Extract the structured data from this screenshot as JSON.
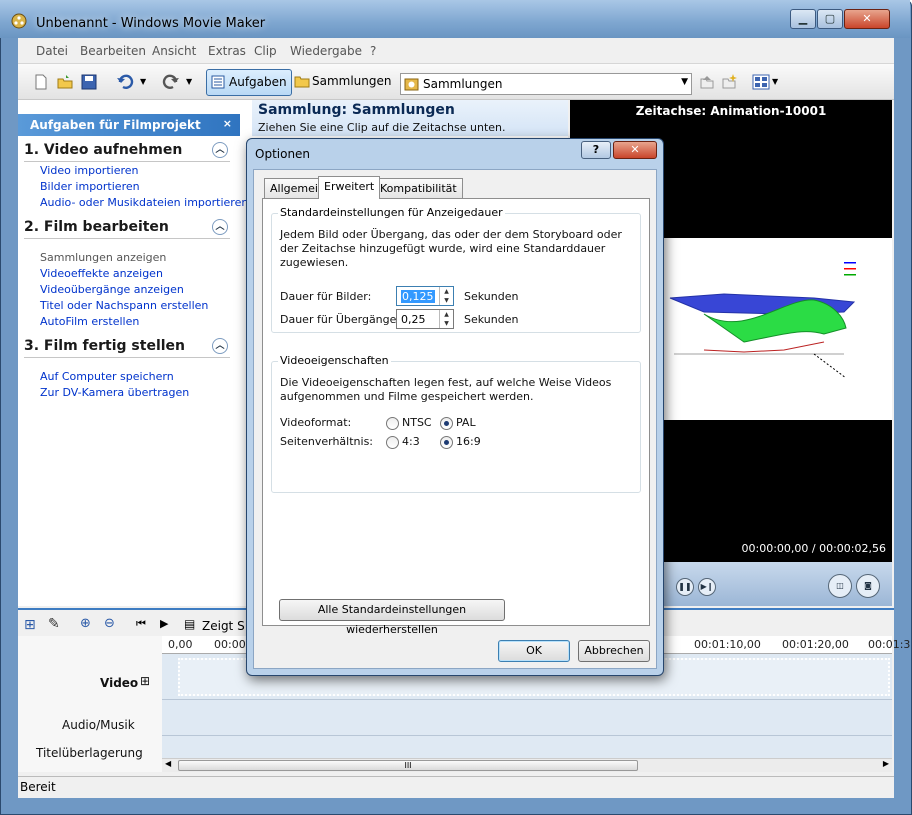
{
  "window": {
    "title": "Unbenannt - Windows Movie Maker",
    "min": "▁",
    "max": "▢",
    "close": "✕"
  },
  "menu": [
    "Datei",
    "Bearbeiten",
    "Ansicht",
    "Extras",
    "Clip",
    "Wiedergabe",
    "?"
  ],
  "toolbar": {
    "aufgaben": "Aufgaben",
    "sammlungen": "Sammlungen",
    "combo": "Sammlungen"
  },
  "tasks": {
    "header": "Aufgaben für Filmprojekt",
    "close": "×",
    "sections": [
      {
        "title": "1. Video aufnehmen",
        "links": [
          "Video importieren",
          "Bilder importieren",
          "Audio- oder Musikdateien importieren"
        ]
      },
      {
        "title": "2. Film bearbeiten",
        "links": [
          "Sammlungen anzeigen",
          "Videoeffekte anzeigen",
          "Videoübergänge anzeigen",
          "Titel oder Nachspann erstellen",
          "AutoFilm erstellen"
        ]
      },
      {
        "title": "3. Film fertig stellen",
        "links": [
          "Auf Computer speichern",
          "Zur DV-Kamera übertragen"
        ]
      }
    ]
  },
  "collection": {
    "title": "Sammlung: Sammlungen",
    "subtitle": "Ziehen Sie eine Clip auf die Zeitachse unten."
  },
  "preview": {
    "title": "Zeitachse: Animation-10001",
    "time": "00:00:00,00 / 00:00:02,56"
  },
  "timeline": {
    "zeigt": "Zeigt S",
    "ticks": [
      "0,00",
      "00:00",
      "00:01:10,00",
      "00:01:20,00",
      "00:01:3"
    ],
    "tracks": {
      "video": "Video",
      "expand": "⊞",
      "audio": "Audio/Musik",
      "title": "Titelüberlagerung"
    },
    "scroll_grip": "III"
  },
  "status": "Bereit",
  "dialog": {
    "title": "Optionen",
    "help": "?",
    "close": "✕",
    "tabs": [
      "Allgemein",
      "Erweitert",
      "Kompatibilität"
    ],
    "active_tab": "Erweitert",
    "duration_group": {
      "title": "Standardeinstellungen für Anzeigedauer",
      "desc": "Jedem Bild oder Übergang, das oder der dem Storyboard oder der Zeitachse hinzugefügt wurde, wird eine Standarddauer zugewiesen.",
      "pictures_label": "Dauer für Bilder:",
      "pictures_value": "0,125",
      "transitions_label": "Dauer für Übergänge:",
      "transitions_value": "0,25",
      "unit": "Sekunden"
    },
    "video_group": {
      "title": "Videoeigenschaften",
      "desc": "Die Videoeigenschaften legen fest, auf welche Weise Videos aufgenommen und Filme gespeichert werden.",
      "format_label": "Videoformat:",
      "format_options": [
        "NTSC",
        "PAL"
      ],
      "format_selected": "PAL",
      "aspect_label": "Seitenverhältnis:",
      "aspect_options": [
        "4:3",
        "16:9"
      ],
      "aspect_selected": "16:9"
    },
    "restore_button": "Alle Standardeinstellungen wiederherstellen",
    "ok": "OK",
    "cancel": "Abbrechen"
  },
  "colors": {
    "accent": "#3e7cc2",
    "link": "#0033cc",
    "selected_text_bg": "#3399ff"
  }
}
